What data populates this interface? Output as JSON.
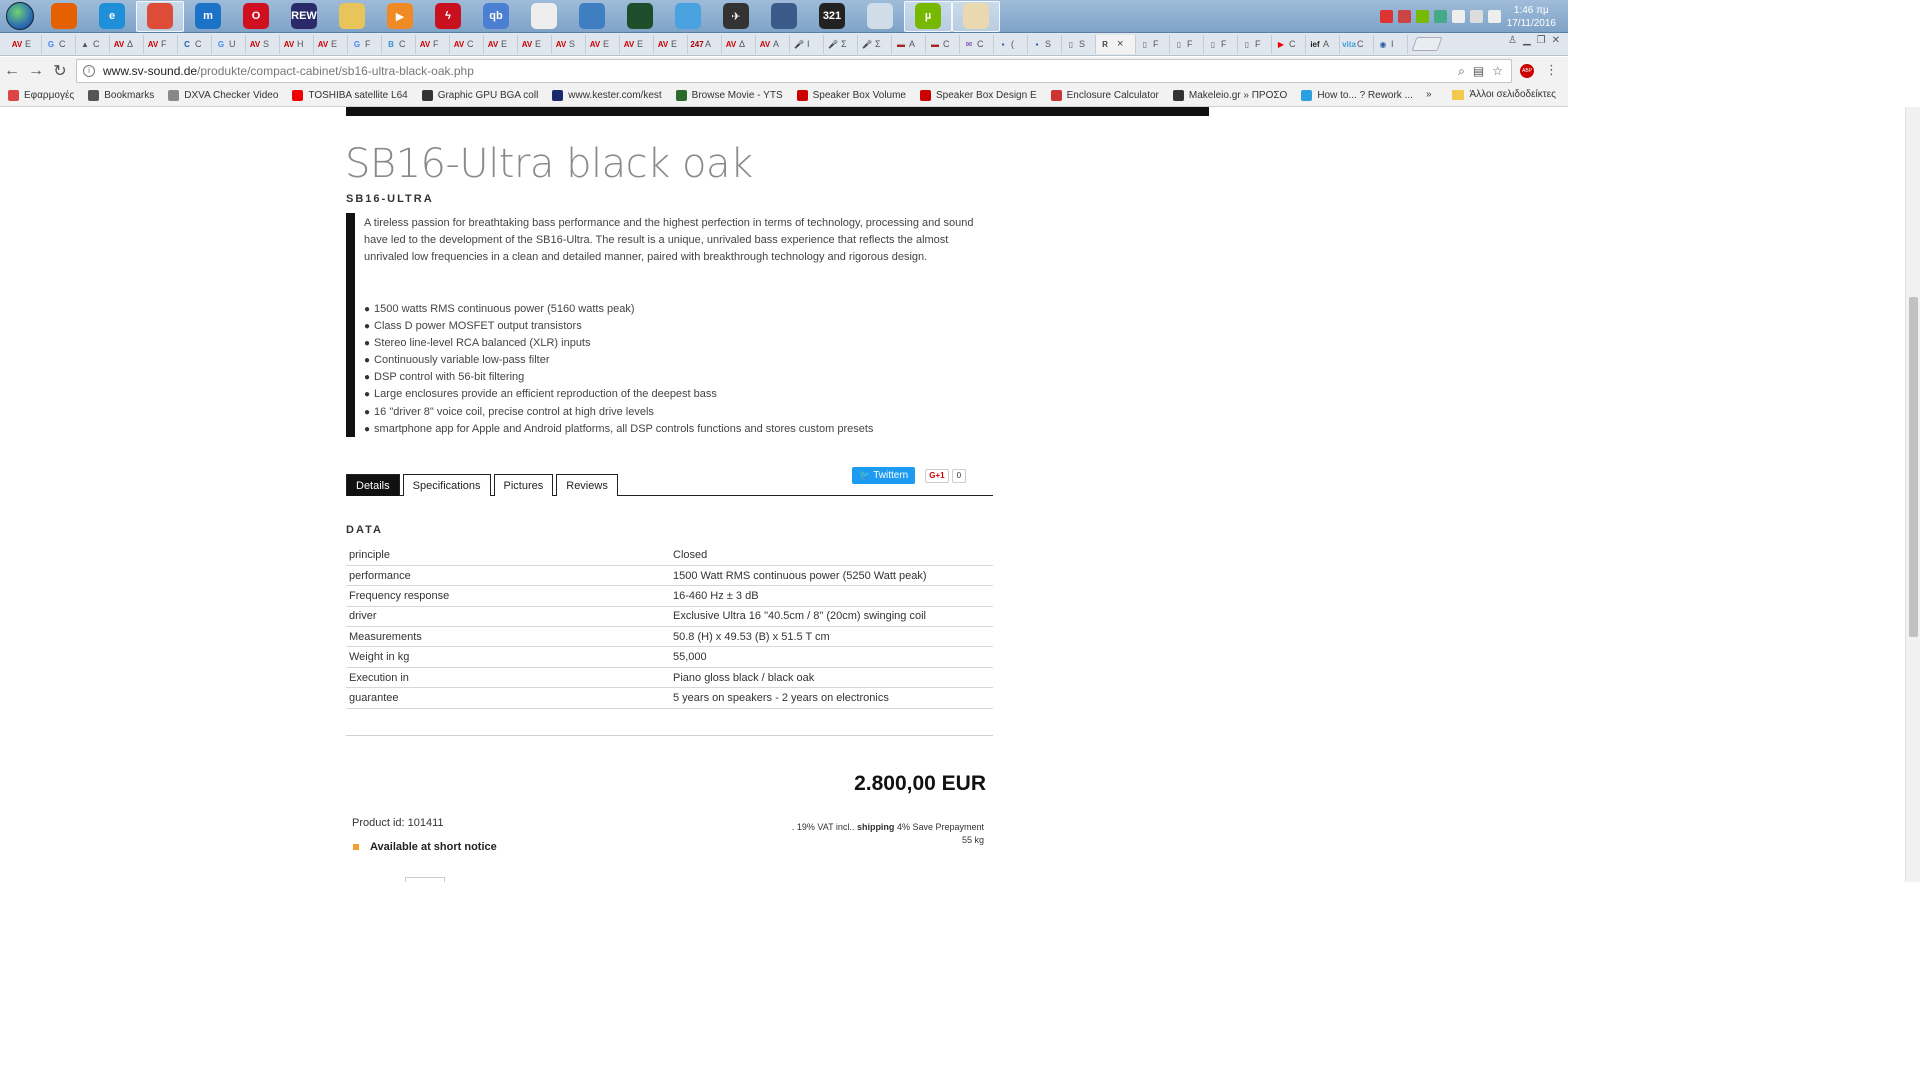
{
  "taskbar": {
    "apps": [
      {
        "name": "firefox",
        "color": "#e66000",
        "glyph": ""
      },
      {
        "name": "internet-explorer",
        "color": "#1f8fd8",
        "glyph": "e"
      },
      {
        "name": "chrome",
        "color": "#dd4b39",
        "glyph": "",
        "active": true
      },
      {
        "name": "maxthon",
        "color": "#1b72c6",
        "glyph": "m"
      },
      {
        "name": "opera",
        "color": "#d01020",
        "glyph": "O"
      },
      {
        "name": "rew",
        "color": "#2a2a6a",
        "glyph": "REW"
      },
      {
        "name": "file-explorer",
        "color": "#e8c45a",
        "glyph": ""
      },
      {
        "name": "media-player",
        "color": "#f08a24",
        "glyph": "▶"
      },
      {
        "name": "flash",
        "color": "#c8101e",
        "glyph": "ϟ"
      },
      {
        "name": "qbittorrent",
        "color": "#4a7fd1",
        "glyph": "qb"
      },
      {
        "name": "alien-app",
        "color": "#eeeeee",
        "glyph": ""
      },
      {
        "name": "settings-app",
        "color": "#3f7ec1",
        "glyph": ""
      },
      {
        "name": "audio-app",
        "color": "#1d4d2a",
        "glyph": ""
      },
      {
        "name": "drop-app",
        "color": "#4aa3e0",
        "glyph": ""
      },
      {
        "name": "plane-app",
        "color": "#333333",
        "glyph": "✈"
      },
      {
        "name": "speaker-app",
        "color": "#3a5a8a",
        "glyph": ""
      },
      {
        "name": "clapper-app",
        "color": "#222222",
        "glyph": "321"
      },
      {
        "name": "calculator",
        "color": "#d0dce8",
        "glyph": ""
      },
      {
        "name": "utorrent",
        "color": "#77b800",
        "glyph": "µ",
        "active": true
      },
      {
        "name": "paint",
        "color": "#e9d8b0",
        "glyph": "",
        "active": true
      }
    ],
    "clock": {
      "time": "1:46 πμ",
      "date": "17/11/2016"
    }
  },
  "browser": {
    "url_host": "www.sv-sound.de",
    "url_path": "/produkte/compact-cabinet/sb16-ultra-black-oak.php",
    "tabs": [
      {
        "fav": "AV",
        "color": "#c00",
        "label": "E"
      },
      {
        "fav": "G",
        "color": "#4285f4",
        "label": "C"
      },
      {
        "fav": "▲",
        "color": "#555",
        "label": "C"
      },
      {
        "fav": "AV",
        "color": "#c00",
        "label": "Δ"
      },
      {
        "fav": "AV",
        "color": "#c00",
        "label": "F"
      },
      {
        "fav": "C",
        "color": "#1a5fb4",
        "label": "C"
      },
      {
        "fav": "G",
        "color": "#4285f4",
        "label": "U"
      },
      {
        "fav": "AV",
        "color": "#c00",
        "label": "S"
      },
      {
        "fav": "AV",
        "color": "#c00",
        "label": "H"
      },
      {
        "fav": "AV",
        "color": "#c00",
        "label": "E"
      },
      {
        "fav": "G",
        "color": "#4285f4",
        "label": "F"
      },
      {
        "fav": "B",
        "color": "#3b8fd4",
        "label": "C"
      },
      {
        "fav": "AV",
        "color": "#c00",
        "label": "F"
      },
      {
        "fav": "AV",
        "color": "#c00",
        "label": "C"
      },
      {
        "fav": "AV",
        "color": "#c00",
        "label": "E"
      },
      {
        "fav": "AV",
        "color": "#c00",
        "label": "E"
      },
      {
        "fav": "AV",
        "color": "#c00",
        "label": "S"
      },
      {
        "fav": "AV",
        "color": "#c00",
        "label": "E"
      },
      {
        "fav": "AV",
        "color": "#c00",
        "label": "E"
      },
      {
        "fav": "AV",
        "color": "#c00",
        "label": "E"
      },
      {
        "fav": "247",
        "color": "#a00",
        "label": "A"
      },
      {
        "fav": "AV",
        "color": "#c00",
        "label": "Δ"
      },
      {
        "fav": "AV",
        "color": "#c00",
        "label": "A"
      },
      {
        "fav": "🎤",
        "color": "#333",
        "label": "I"
      },
      {
        "fav": "🎤",
        "color": "#333",
        "label": "Σ"
      },
      {
        "fav": "🎤",
        "color": "#333",
        "label": "Σ"
      },
      {
        "fav": "▬",
        "color": "#a22",
        "label": "A"
      },
      {
        "fav": "▬",
        "color": "#a22",
        "label": "C"
      },
      {
        "fav": "✉",
        "color": "#6a3da8",
        "label": "C"
      },
      {
        "fav": "▪",
        "color": "#2a5aa8",
        "label": "("
      },
      {
        "fav": "▪",
        "color": "#2a5aa8",
        "label": "S"
      },
      {
        "fav": "▯",
        "color": "#666",
        "label": "S"
      },
      {
        "fav": "R",
        "color": "#444",
        "label": "",
        "active": true
      },
      {
        "fav": "▯",
        "color": "#666",
        "label": "F"
      },
      {
        "fav": "▯",
        "color": "#666",
        "label": "F"
      },
      {
        "fav": "▯",
        "color": "#666",
        "label": "F"
      },
      {
        "fav": "▯",
        "color": "#666",
        "label": "F"
      },
      {
        "fav": "▶",
        "color": "#e00",
        "label": "C"
      },
      {
        "fav": "ief",
        "color": "#222",
        "label": "A"
      },
      {
        "fav": "vita",
        "color": "#3ca0d8",
        "label": "C"
      },
      {
        "fav": "◉",
        "color": "#2a5aa8",
        "label": "I"
      }
    ],
    "bookmarks": [
      {
        "label": "Εφαρμογές",
        "color": "#d44"
      },
      {
        "label": "Bookmarks",
        "color": "#555"
      },
      {
        "label": "DXVA Checker Video",
        "color": "#888"
      },
      {
        "label": "TOSHIBA satellite L64",
        "color": "#e00"
      },
      {
        "label": "Graphic GPU BGA coll",
        "color": "#333"
      },
      {
        "label": "www.kester.com/kest",
        "color": "#1a2a6a"
      },
      {
        "label": "Browse Movie - YTS",
        "color": "#2a6a2a"
      },
      {
        "label": "Speaker Box Volume",
        "color": "#c00"
      },
      {
        "label": "Speaker Box Design E",
        "color": "#c00"
      },
      {
        "label": "Enclosure Calculator",
        "color": "#c33"
      },
      {
        "label": "Makeleio.gr » ΠΡΟΣΟ",
        "color": "#333"
      },
      {
        "label": "How to... ? Rework ...",
        "color": "#2aa0e0"
      }
    ],
    "bookmarks_more": "»",
    "other_bookmarks": "Άλλοι σελιδοδείκτες"
  },
  "product": {
    "title": "SB16-Ultra black oak",
    "subtitle": "SB16-ULTRA",
    "description": "A tireless passion for breathtaking bass performance and the highest perfection in terms of technology, processing and sound have led to the development of the SB16-Ultra. The result is a unique, unrivaled bass experience that reflects the almost unrivaled low frequencies in a clean and detailed manner, paired with breakthrough technology and rigorous design.",
    "features": [
      "1500 watts RMS continuous power (5160 watts peak)",
      "Class D power MOSFET output transistors",
      "Stereo line-level RCA balanced (XLR) inputs",
      "Continuously variable low-pass filter",
      "DSP control with 56-bit filtering",
      "Large enclosures provide an efficient reproduction of the deepest bass",
      "16 \"driver 8\" voice coil, precise control at high drive levels",
      "smartphone app for Apple and Android platforms, all DSP controls functions and stores custom presets"
    ],
    "social": {
      "tweet_label": "Twittern",
      "gplus_label": "G+1",
      "gplus_count": "0"
    },
    "tabs": [
      "Details",
      "Specifications",
      "Pictures",
      "Reviews"
    ],
    "data_heading": "DATA",
    "specs": [
      {
        "key": "principle",
        "value": "Closed"
      },
      {
        "key": "performance",
        "value": "1500 Watt RMS continuous power (5250 Watt peak)"
      },
      {
        "key": "Frequency response",
        "value": "16-460 Hz ± 3 dB"
      },
      {
        "key": "driver",
        "value": "Exclusive Ultra 16 \"40.5cm / 8\" (20cm) swinging coil"
      },
      {
        "key": "Measurements",
        "value": "50.8 (H) x 49.53 (B) x 51.5 T cm"
      },
      {
        "key": "Weight in kg",
        "value": "55,000"
      },
      {
        "key": "Execution in",
        "value": "Piano gloss black / black oak"
      },
      {
        "key": "guarantee",
        "value": "5 years on speakers - 2 years on electronics"
      }
    ],
    "price": "2.800,00 EUR",
    "product_id": "Product id: 101411",
    "vat_prefix": ". 19% VAT incl.. ",
    "vat_shipping": "shipping",
    "vat_suffix": " 4% Save Prepayment",
    "weight_note": "55 kg",
    "availability": "Available at short notice"
  }
}
